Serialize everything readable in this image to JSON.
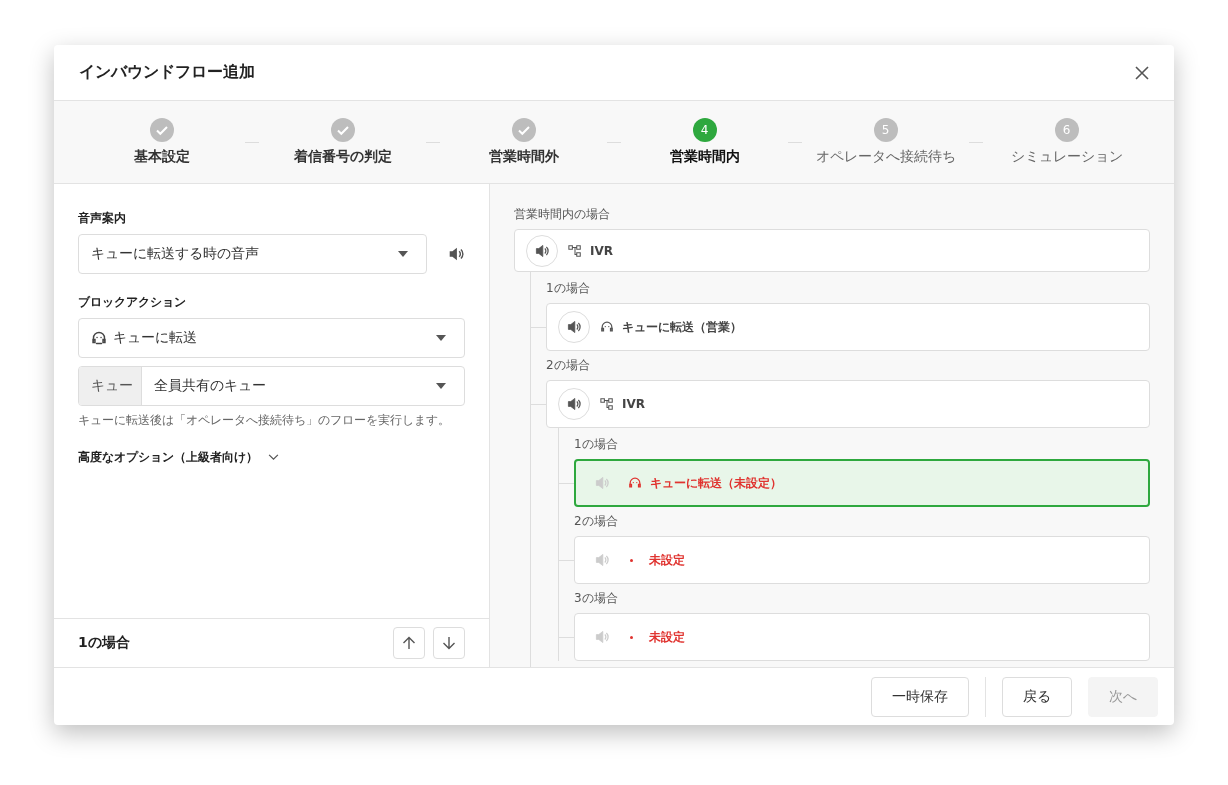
{
  "dialog": {
    "title": "インバウンドフロー追加"
  },
  "steps": [
    {
      "label": "基本設定",
      "completed": true,
      "selected": false
    },
    {
      "label": "着信番号の判定",
      "completed": true,
      "selected": false
    },
    {
      "label": "営業時間外",
      "completed": true,
      "selected": false
    },
    {
      "label": "営業時間内",
      "completed": false,
      "selected": true,
      "number": "4"
    },
    {
      "label": "オペレータへ接続待ち",
      "completed": false,
      "selected": false,
      "number": "5"
    },
    {
      "label": "シミュレーション",
      "completed": false,
      "selected": false,
      "number": "6"
    }
  ],
  "form": {
    "voice_label": "音声案内",
    "voice_value": "キューに転送する時の音声",
    "action_label": "ブロックアクション",
    "action_value": "キューに転送",
    "queue_prefix": "キュー",
    "queue_value": "全員共有のキュー",
    "hint": "キューに転送後は「オペレータへ接続待ち」のフローを実行します。",
    "advanced": "高度なオプション（上級者向け）",
    "expanded": false
  },
  "case_bar": {
    "title": "1の場合"
  },
  "flow": {
    "label": "営業時間内の場合",
    "node": {
      "kind": "ivr",
      "text": "IVR",
      "audio": true,
      "error": false,
      "selected": false
    },
    "children": [
      {
        "label": "1の場合",
        "node": {
          "kind": "queue",
          "text": "キューに転送（営業）",
          "audio": true,
          "error": false,
          "selected": false
        }
      },
      {
        "label": "2の場合",
        "node": {
          "kind": "ivr",
          "text": "IVR",
          "audio": true,
          "error": false,
          "selected": false
        },
        "children": [
          {
            "label": "1の場合",
            "node": {
              "kind": "queue",
              "text": "キューに転送（未設定）",
              "audio": false,
              "error": true,
              "selected": true
            }
          },
          {
            "label": "2の場合",
            "node": {
              "kind": "unset",
              "text": "未設定",
              "audio": false,
              "error": true,
              "selected": false
            }
          },
          {
            "label": "3の場合",
            "node": {
              "kind": "unset",
              "text": "未設定",
              "audio": false,
              "error": true,
              "selected": false
            }
          }
        ]
      }
    ]
  },
  "footer": {
    "buttons": [
      {
        "label": "一時保存",
        "disabled": false
      },
      {
        "label": "戻る",
        "disabled": false
      },
      {
        "label": "次へ",
        "disabled": true
      }
    ]
  }
}
